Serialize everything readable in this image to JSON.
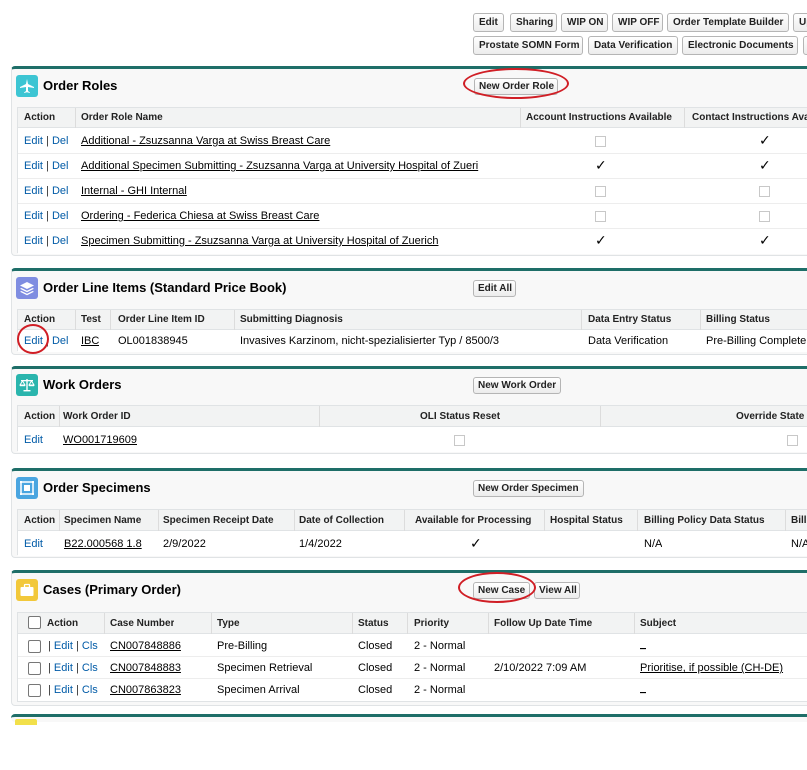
{
  "top_buttons": {
    "edit": "Edit",
    "sharing": "Sharing",
    "wip_on": "WIP ON",
    "wip_off": "WIP OFF",
    "order_template_builder": "Order Template Builder",
    "up": "Up",
    "prostate_somn_form": "Prostate SOMN Form",
    "data_verification": "Data Verification",
    "electronic_documents": "Electronic Documents"
  },
  "order_roles": {
    "title": "Order Roles",
    "new_button": "New Order Role",
    "columns": [
      "Action",
      "Order Role Name",
      "Account Instructions Available",
      "Contact Instructions Available"
    ],
    "rows": [
      {
        "edit": "Edit",
        "sep": "|",
        "del": "Del",
        "name": "Additional - Zsuzsanna Varga at Swiss Breast Care",
        "account_instr": false,
        "contact_instr": true
      },
      {
        "edit": "Edit",
        "sep": "|",
        "del": "Del",
        "name": "Additional Specimen Submitting - Zsuzsanna Varga at University Hospital of Zueri",
        "account_instr": true,
        "contact_instr": true
      },
      {
        "edit": "Edit",
        "sep": "|",
        "del": "Del",
        "name": "Internal - GHI Internal",
        "account_instr": false,
        "contact_instr": false
      },
      {
        "edit": "Edit",
        "sep": "|",
        "del": "Del",
        "name": "Ordering - Federica Chiesa at Swiss Breast Care",
        "account_instr": false,
        "contact_instr": false
      },
      {
        "edit": "Edit",
        "sep": "|",
        "del": "Del",
        "name": "Specimen Submitting - Zsuzsanna Varga at University Hospital of Zuerich",
        "account_instr": true,
        "contact_instr": true
      }
    ]
  },
  "order_line_items": {
    "title": "Order Line Items (Standard Price Book)",
    "edit_all_button": "Edit All",
    "columns": [
      "Action",
      "Test",
      "Order Line Item ID",
      "Submitting Diagnosis",
      "Data Entry Status",
      "Billing Status"
    ],
    "rows": [
      {
        "edit": "Edit",
        "sep": "|",
        "del": "Del",
        "test": "IBC",
        "oli_id": "OL001838945",
        "diagnosis": "Invasives Karzinom, nicht-spezialisierter Typ / 8500/3",
        "data_entry_status": "Data Verification",
        "billing_status": "Pre-Billing Complete"
      }
    ]
  },
  "work_orders": {
    "title": "Work Orders",
    "new_button": "New Work Order",
    "columns": [
      "Action",
      "Work Order ID",
      "OLI Status Reset",
      "Override State"
    ],
    "rows": [
      {
        "edit": "Edit",
        "wo_id": "WO001719609",
        "oli_status_reset": false,
        "override_state": false
      }
    ]
  },
  "order_specimens": {
    "title": "Order Specimens",
    "new_button": "New Order Specimen",
    "columns": [
      "Action",
      "Specimen Name",
      "Specimen Receipt Date",
      "Date of Collection",
      "Available for Processing",
      "Hospital Status",
      "Billing Policy Data Status",
      "Billi"
    ],
    "rows": [
      {
        "edit": "Edit",
        "name": "B22.000568 1.8",
        "receipt_date": "2/9/2022",
        "collection_date": "1/4/2022",
        "available": true,
        "hospital_status": "",
        "billing_policy": "N/A",
        "billi": "N/A"
      }
    ]
  },
  "cases": {
    "title": "Cases (Primary Order)",
    "new_button": "New Case",
    "view_all_button": "View All",
    "columns": [
      "Action",
      "Case Number",
      "Type",
      "Status",
      "Priority",
      "Follow Up Date Time",
      "Subject"
    ],
    "rows": [
      {
        "edit": "Edit",
        "sep": "|",
        "cls": "Cls",
        "case_number": "CN007848886",
        "type": "Pre-Billing",
        "status": "Closed",
        "priority": "2 - Normal",
        "follow_up": "",
        "subject": "_"
      },
      {
        "edit": "Edit",
        "sep": "|",
        "cls": "Cls",
        "case_number": "CN007848883",
        "type": "Specimen Retrieval",
        "status": "Closed",
        "priority": "2 - Normal",
        "follow_up": "2/10/2022 7:09 AM",
        "subject": "Prioritise, if possible (CH-DE)"
      },
      {
        "edit": "Edit",
        "sep": "|",
        "cls": "Cls",
        "case_number": "CN007863823",
        "type": "Specimen Arrival",
        "status": "Closed",
        "priority": "2 - Normal",
        "follow_up": "",
        "subject": "_"
      }
    ]
  },
  "colors": {
    "section_border": "#1e6e68",
    "link": "#015ba7",
    "annotation_red": "#d01e25",
    "order_roles_icon": "#3dc5d3",
    "oli_icon": "#7f8de1",
    "work_orders_icon": "#2ab5ad",
    "specimens_icon": "#4aa5e0",
    "cases_icon": "#f2c83a"
  },
  "icons": {
    "order_roles": "airplane-icon",
    "order_line_items": "stack-icon",
    "work_orders": "scales-icon",
    "order_specimens": "frame-icon",
    "cases": "briefcase-icon"
  }
}
